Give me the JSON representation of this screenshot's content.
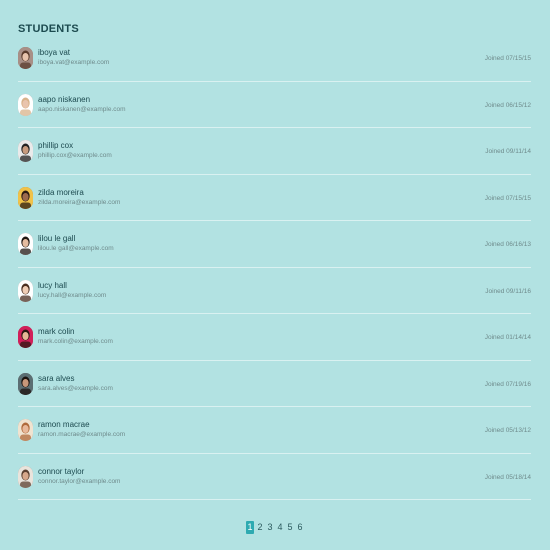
{
  "header": {
    "title": "STUDENTS"
  },
  "students": [
    {
      "name": "iboya vat",
      "email": "iboya.vat@example.com",
      "joined": "Joined 07/15/15",
      "avatar": "avatar-photo"
    },
    {
      "name": "aapo niskanen",
      "email": "aapo.niskanen@example.com",
      "joined": "Joined 06/15/12",
      "avatar": "avatar-photo"
    },
    {
      "name": "phillip cox",
      "email": "phillip.cox@example.com",
      "joined": "Joined 09/11/14",
      "avatar": "avatar-photo"
    },
    {
      "name": "zilda moreira",
      "email": "zilda.moreira@example.com",
      "joined": "Joined 07/15/15",
      "avatar": "avatar-photo"
    },
    {
      "name": "lilou le gall",
      "email": "lilou.le gall@example.com",
      "joined": "Joined 06/16/13",
      "avatar": "avatar-photo"
    },
    {
      "name": "lucy hall",
      "email": "lucy.hall@example.com",
      "joined": "Joined 09/11/16",
      "avatar": "avatar-photo"
    },
    {
      "name": "mark colin",
      "email": "mark.colin@example.com",
      "joined": "Joined 01/14/14",
      "avatar": "avatar-photo"
    },
    {
      "name": "sara alves",
      "email": "sara.alves@example.com",
      "joined": "Joined 07/19/16",
      "avatar": "avatar-photo"
    },
    {
      "name": "ramon macrae",
      "email": "ramon.macrae@example.com",
      "joined": "Joined 05/13/12",
      "avatar": "avatar-photo"
    },
    {
      "name": "connor taylor",
      "email": "connor.taylor@example.com",
      "joined": "Joined 05/18/14",
      "avatar": "avatar-photo"
    }
  ],
  "pagination": {
    "pages": [
      "1",
      "2",
      "3",
      "4",
      "5",
      "6"
    ],
    "current": "1"
  },
  "colors": {
    "background": "#b2e2e2",
    "accent": "#2eaab1",
    "text_primary": "#1c4a4f",
    "text_secondary": "#6f8b8c"
  }
}
